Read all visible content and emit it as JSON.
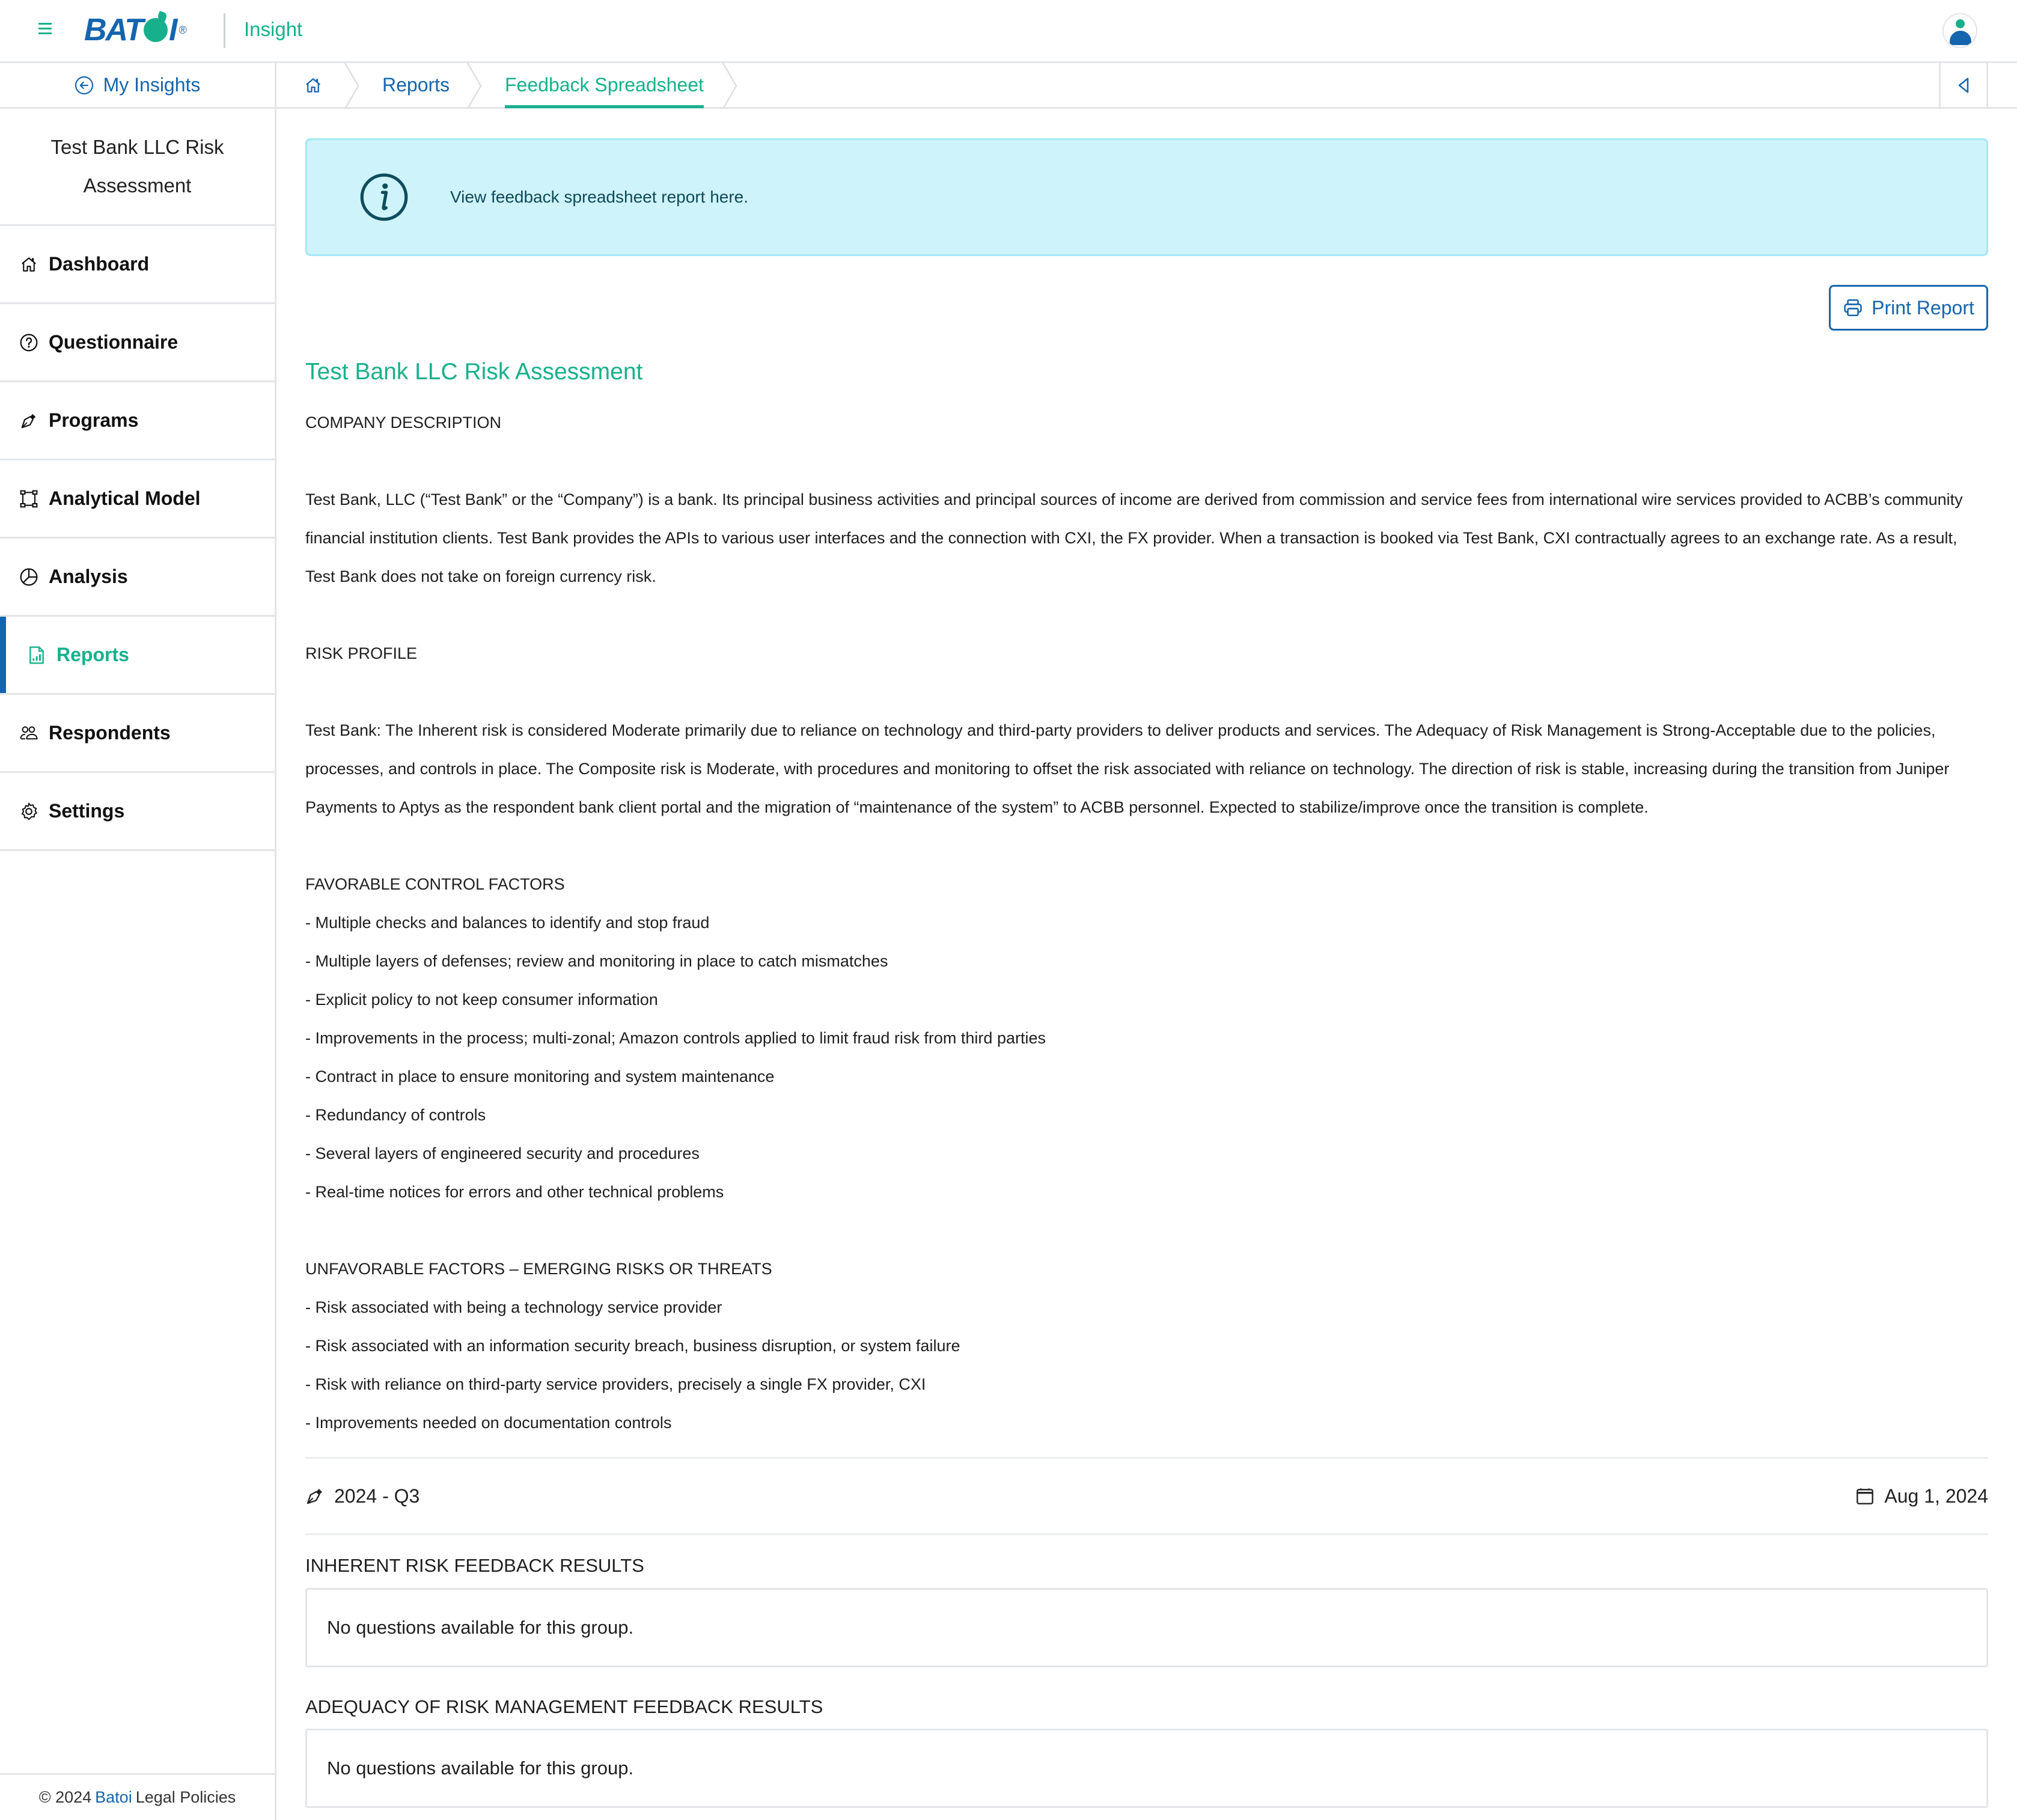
{
  "header": {
    "logo_text_left": "BAT",
    "logo_text_right": "I",
    "logo_reg": "®",
    "app_name": "Insight",
    "menu_icon": "hamburger-icon",
    "avatar_icon": "user-avatar-icon"
  },
  "sidebar": {
    "back_link": "My Insights",
    "assessment_title": "Test Bank LLC Risk Assessment",
    "items": [
      {
        "label": "Dashboard",
        "icon": "home-icon",
        "active": false
      },
      {
        "label": "Questionnaire",
        "icon": "question-circle-icon",
        "active": false
      },
      {
        "label": "Programs",
        "icon": "pen-nib-icon",
        "active": false
      },
      {
        "label": "Analytical Model",
        "icon": "vector-square-icon",
        "active": false
      },
      {
        "label": "Analysis",
        "icon": "pie-chart-icon",
        "active": false
      },
      {
        "label": "Reports",
        "icon": "report-chart-icon",
        "active": true
      },
      {
        "label": "Respondents",
        "icon": "people-icon",
        "active": false
      },
      {
        "label": "Settings",
        "icon": "gear-icon",
        "active": false
      }
    ],
    "footer": {
      "copyright": "© 2024",
      "brand": "Batoi",
      "legal": "Legal Policies"
    }
  },
  "breadcrumb": {
    "home_icon": "home-icon",
    "items": [
      "Reports",
      "Feedback Spreadsheet"
    ],
    "collapse_icon": "caret-left-icon"
  },
  "alert": {
    "icon": "info-circle-icon",
    "message": "View feedback spreadsheet report here."
  },
  "toolbar": {
    "print_label": "Print Report",
    "print_icon": "printer-icon"
  },
  "report": {
    "title": "Test Bank LLC Risk Assessment",
    "lines": [
      "COMPANY DESCRIPTION",
      "",
      "Test Bank, LLC (“Test Bank” or the “Company”) is a bank. Its principal business activities and principal sources of income are derived from commission and service fees from international wire services provided to ACBB’s community financial institution clients. Test Bank provides the APIs to various user interfaces and the connection with CXI, the FX provider. When a transaction is booked via Test Bank, CXI contractually agrees to an exchange rate. As a result, Test Bank does not take on foreign currency risk.",
      "",
      "RISK PROFILE",
      "",
      "Test Bank: The Inherent risk is considered Moderate primarily due to reliance on technology and third-party providers to deliver products and services. The Adequacy of Risk Management is Strong-Acceptable due to the policies, processes, and controls in place. The Composite risk is Moderate, with procedures and monitoring to offset the risk associated with reliance on technology. The direction of risk is stable, increasing during the transition from Juniper Payments to Aptys as the respondent bank client portal and the migration of “maintenance of the system” to ACBB personnel. Expected to stabilize/improve once the transition is complete.",
      "",
      "FAVORABLE CONTROL FACTORS",
      "- Multiple checks and balances to identify and stop fraud",
      "- Multiple layers of defenses; review and monitoring in place to catch mismatches",
      "- Explicit policy to not keep consumer information",
      "- Improvements in the process; multi-zonal; Amazon controls applied to limit fraud risk from third parties",
      "- Contract in place to ensure monitoring and system maintenance",
      "- Redundancy of controls",
      "- Several layers of engineered security and procedures",
      "- Real-time notices for errors and other technical problems",
      "",
      "UNFAVORABLE FACTORS – EMERGING RISKS OR THREATS",
      "- Risk associated with being a technology service provider",
      "- Risk associated with an information security breach, business disruption, or system failure",
      "- Risk with reliance on third-party service providers, precisely a single FX provider, CXI",
      "- Improvements needed on documentation controls"
    ]
  },
  "meta": {
    "period": "2024 - Q3",
    "period_icon": "pen-nib-icon",
    "date": "Aug 1, 2024",
    "date_icon": "calendar-icon"
  },
  "groups": [
    {
      "title": "INHERENT RISK FEEDBACK RESULTS",
      "empty_message": "No questions available for this group."
    },
    {
      "title": "ADEQUACY OF RISK MANAGEMENT FEEDBACK RESULTS",
      "empty_message": "No questions available for this group."
    }
  ],
  "colors": {
    "brand_blue": "#1565ae",
    "brand_green": "#17b08c",
    "alert_bg": "#cff3fa",
    "alert_border": "#a6e8f6",
    "border": "#e3e5e8"
  }
}
